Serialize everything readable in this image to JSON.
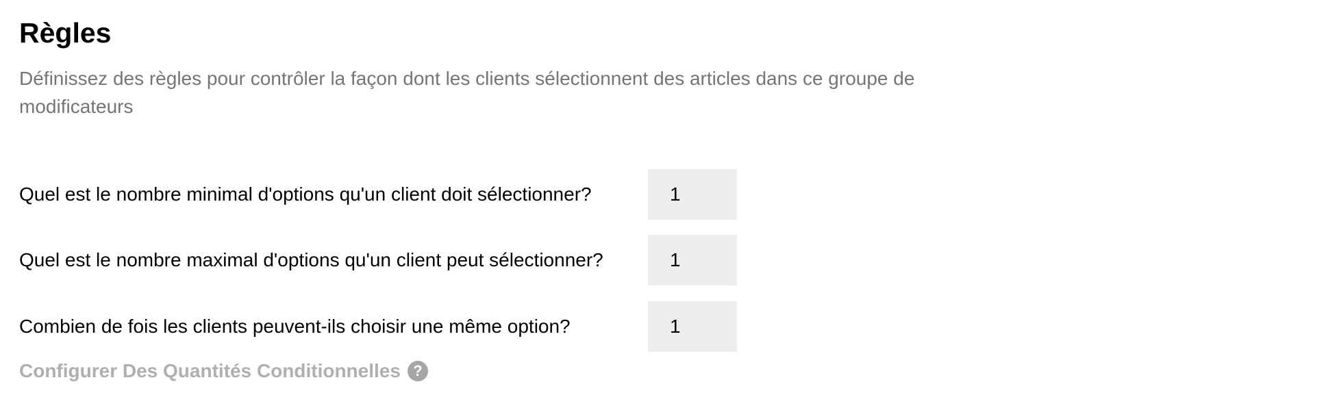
{
  "section": {
    "title": "Règles",
    "description": "Définissez des règles pour contrôler la façon dont les clients sélectionnent des articles dans ce groupe de modificateurs"
  },
  "rules": [
    {
      "label": "Quel est le nombre minimal d'options qu'un client doit sélectionner?",
      "value": "1"
    },
    {
      "label": "Quel est le nombre maximal d'options qu'un client peut sélectionner?",
      "value": "1"
    },
    {
      "label": "Combien de fois les clients peuvent-ils choisir une même option?",
      "value": "1"
    }
  ],
  "conditional_quantities": {
    "label": "Configurer Des Quantités Conditionnelles",
    "icon": "question-circle-icon",
    "icon_glyph": "?"
  },
  "colors": {
    "title_text": "#000000",
    "description_text": "#757575",
    "input_background": "#eeeeee",
    "link_text": "#afafaf",
    "help_icon": "#a6a6a6"
  }
}
